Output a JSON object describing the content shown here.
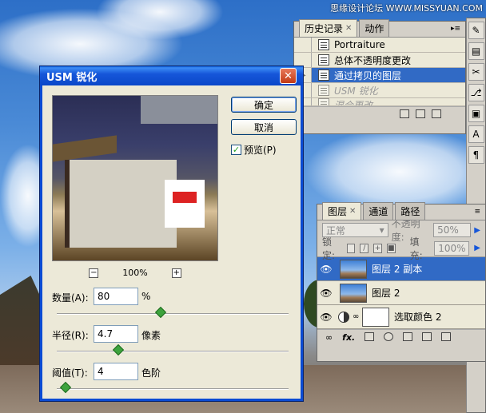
{
  "watermark": "思缘设计论坛 WWW.MISSYUAN.COM",
  "usm_dialog": {
    "title": "USM 锐化",
    "ok_label": "确定",
    "cancel_label": "取消",
    "preview_label": "预览(P)",
    "preview_checked": true,
    "zoom_minus": "−",
    "zoom_plus": "+",
    "zoom_level": "100%",
    "amount_label": "数量(A):",
    "amount_value": "80",
    "amount_unit": "%",
    "amount_slider": 0.45,
    "radius_label": "半径(R):",
    "radius_value": "4.7",
    "radius_unit": "像素",
    "radius_slider": 0.26,
    "threshold_label": "阈值(T):",
    "threshold_value": "4",
    "threshold_unit": "色阶",
    "threshold_slider": 0.02
  },
  "history_panel": {
    "tabs": [
      {
        "label": "历史记录",
        "active": true,
        "closable": true
      },
      {
        "label": "动作",
        "active": false,
        "closable": false
      }
    ],
    "items": [
      {
        "label": "Portraiture",
        "state": "normal"
      },
      {
        "label": "总体不透明度更改",
        "state": "normal"
      },
      {
        "label": "通过拷贝的图层",
        "state": "selected"
      },
      {
        "label": "USM 锐化",
        "state": "dimmed"
      },
      {
        "label": "混合更改",
        "state": "dimmed"
      }
    ]
  },
  "layers_panel": {
    "tabs": [
      {
        "label": "图层",
        "active": true,
        "closable": true
      },
      {
        "label": "通道",
        "active": false,
        "closable": false
      },
      {
        "label": "路径",
        "active": false,
        "closable": false
      }
    ],
    "blend_mode": "正常",
    "opacity_label": "不透明度:",
    "opacity_value": "50%",
    "lock_label": "锁定:",
    "fill_label": "填充:",
    "fill_value": "100%",
    "fx_label": "fx.",
    "layers": [
      {
        "name": "图层 2 副本",
        "kind": "image",
        "selected": true
      },
      {
        "name": "图层 2",
        "kind": "image",
        "selected": false
      },
      {
        "name": "选取颜色 2",
        "kind": "adjustment",
        "selected": false
      }
    ]
  },
  "colors": {
    "title_bar": "#0a47c9",
    "selection": "#316ac5",
    "dialog_bg": "#ece9d8"
  }
}
